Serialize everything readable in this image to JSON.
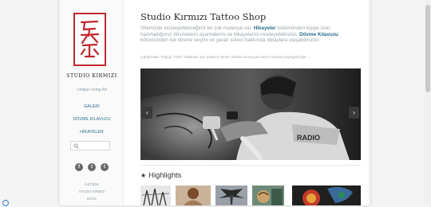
{
  "sidebar": {
    "brand_name": "STUDIO KIRMIZI",
    "tagline": "Unique Living Art",
    "nav": [
      {
        "label": "GALERİ"
      },
      {
        "label": "DÖVME KILAVUZU"
      },
      {
        "label": "HİKAYELER"
      }
    ],
    "search": {
      "placeholder": ""
    },
    "social": [
      {
        "icon": "facebook-icon",
        "glyph": "f"
      },
      {
        "icon": "twitter-icon",
        "glyph": "t"
      },
      {
        "icon": "tumblr-icon",
        "glyph": "t"
      }
    ],
    "footer": [
      {
        "label": "İLETİŞİM"
      },
      {
        "label": "STUDIO KIRMIZI"
      },
      {
        "label": "BLOG"
      }
    ]
  },
  "main": {
    "title": "Studio Kırmızı Tattoo Shop",
    "intro_1": "Sitemizde inceleyebileceğiniz bir çok materyal var. ",
    "intro_hl_1": "Hikayeler",
    "intro_2": " bölümünden kişiye özel hazırladığımız dövmelerin aşamalarını ve hikayelerini inceleyebilirsiniz. ",
    "intro_hl_2": "Dövme Kılavuzu",
    "intro_3": " bölümünden ise dövme seçimi ve yaratı süreci hakkında detaylara ulaşabilirsiniz.",
    "note": "Çalışmalar \"Kişiye Özel\" oldukları için sadece örnek olması amacıyla sınırlı sayıda paylaşılmıştır ...",
    "slider": {
      "prev": "‹",
      "next": "›"
    },
    "highlights_title": "Highlights"
  },
  "colors": {
    "brand_red": "#c0272d",
    "link_blue": "#2a6e8c"
  }
}
